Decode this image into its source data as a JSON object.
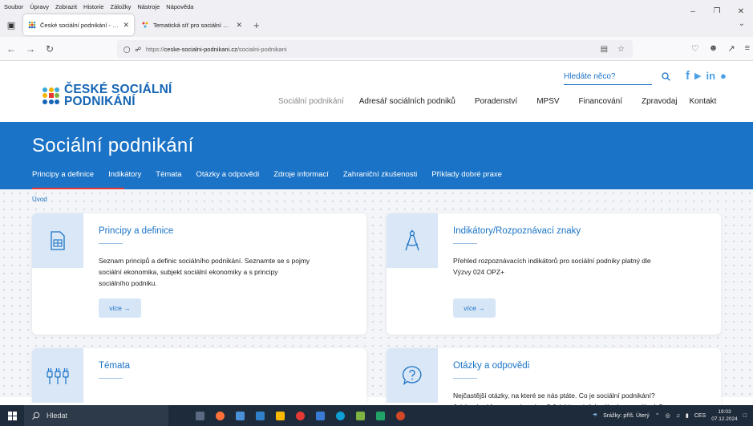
{
  "browser": {
    "menu": [
      "Soubor",
      "Úpravy",
      "Zobrazit",
      "Historie",
      "Záložky",
      "Nástroje",
      "Nápověda"
    ],
    "tabs": [
      {
        "title": "České sociální podnikání - Soci",
        "active": true
      },
      {
        "title": "Tematická síť pro sociální ekon",
        "active": false
      }
    ],
    "url_prefix": "https://",
    "url_domain": "ceske-socialni-podnikani.cz",
    "url_path": "/socialni-podnikani"
  },
  "site": {
    "logo_line1": "ČESKÉ SOCIÁLNÍ",
    "logo_line2": "PODNIKÁNÍ",
    "search_placeholder": "Hledáte něco?",
    "main_nav": [
      "Sociální podnikání",
      "Adresář sociálních podniků",
      "Poradenství",
      "MPSV",
      "Financování",
      "Zpravodaj",
      "Kontakt"
    ],
    "page_title": "Sociální podnikání",
    "sub_nav": [
      "Principy a definice",
      "Indikátory",
      "Témata",
      "Otázky a odpovědi",
      "Zdroje informací",
      "Zahraniční zkušenosti",
      "Příklady dobré praxe"
    ],
    "breadcrumb": "Úvod"
  },
  "cards": [
    {
      "title": "Principy a definice",
      "text": [
        "Seznam principů a definic sociálního podnikání. Seznamte se s pojmy",
        "sociální ekonomika, subjekt sociální ekonomiky a s principy",
        "sociálního podniku."
      ],
      "more": "více →",
      "icon": "table-icon"
    },
    {
      "title": "Indikátory/Rozpoznávací znaky",
      "text": [
        "Přehled rozpoznávacích indikátorů pro sociální podniky platný dle",
        "Výzvy 024 OPZ+"
      ],
      "more": "více →",
      "icon": "compass-icon"
    },
    {
      "title": "Témata",
      "text": [],
      "more": "",
      "icon": "plugs-icon"
    },
    {
      "title": "Otázky a odpovědi",
      "text": [
        "Nejčastější otázky, na které se nás ptáte. Co je sociální podnikání?",
        "Jaké právní formy u nás máme? Jaké jsou jejich výhody a nevýhody?"
      ],
      "more": "",
      "icon": "question-bubble-icon"
    }
  ],
  "taskbar": {
    "search_label": "Hledat",
    "tray_weather": "Srážky: příš. Úterý",
    "tray_lang": "CES",
    "time": "19:03",
    "date": "07.12.2024"
  }
}
